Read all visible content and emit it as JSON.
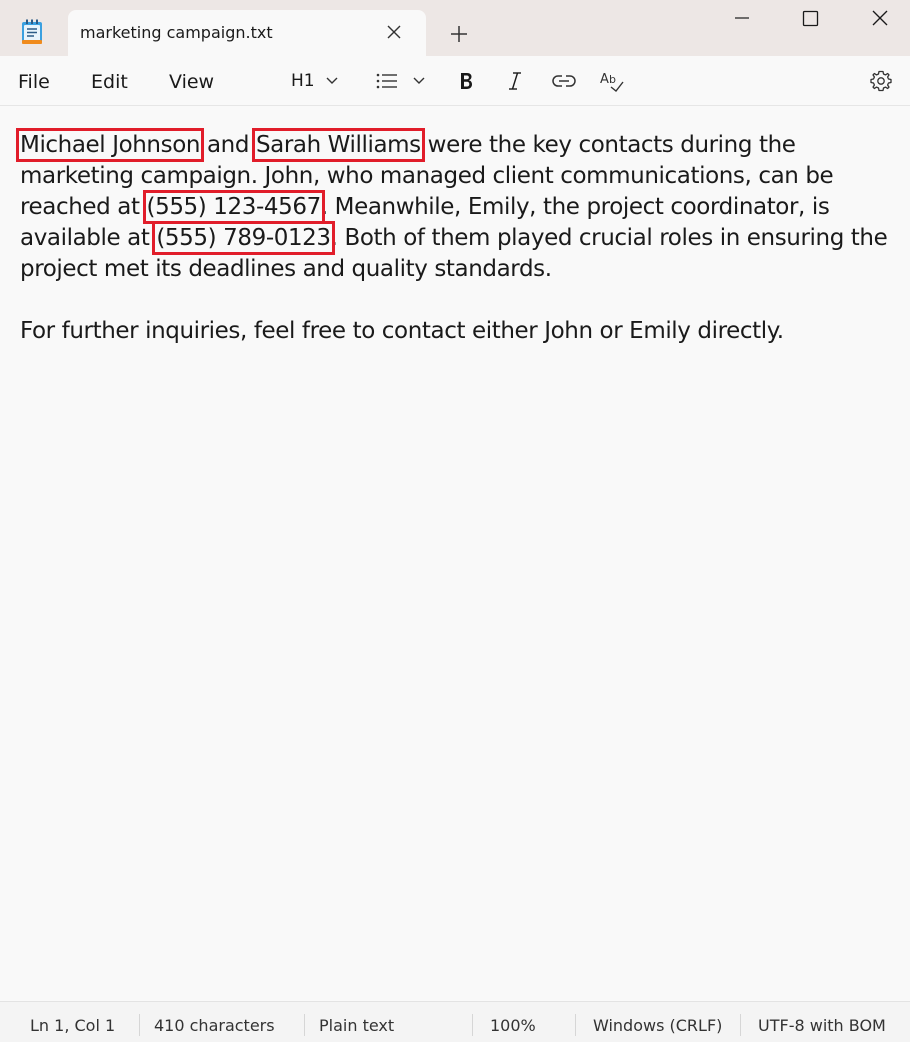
{
  "tab": {
    "title": "marketing campaign.txt"
  },
  "menu": {
    "file": "File",
    "edit": "Edit",
    "view": "View"
  },
  "toolbar": {
    "heading_label": "H1"
  },
  "icons": {
    "app": "notepad-icon",
    "tab_close": "close-icon",
    "new_tab": "plus-icon",
    "minimize": "minimize-icon",
    "maximize": "maximize-icon",
    "close": "close-icon",
    "heading_dropdown": "chevron-down-icon",
    "list": "list-icon",
    "bold": "bold-icon",
    "italic": "italic-icon",
    "link": "link-icon",
    "spellcheck": "spellcheck-icon",
    "settings": "gear-icon"
  },
  "document": {
    "p1": {
      "name1": "Michael Johnson",
      "t1": " and ",
      "name2": "Sarah Williams",
      "t2": " were the key contacts during the marketing campaign. John, who managed client communications, can be reached at ",
      "phone1": " (555)  123-4567",
      "t3": ". Meanwhile, Emily, the project coordinator, is available at ",
      "phone2": " (555)  789-0123",
      "t4": ". Both of them played crucial roles in ensuring the project met its deadlines and quality standards."
    },
    "p2": "For further inquiries, feel free to contact either John or Emily directly."
  },
  "status": {
    "position": "Ln 1, Col 1",
    "characters": "410 characters",
    "format": "Plain text",
    "zoom": "100%",
    "line_endings": "Windows (CRLF)",
    "encoding": "UTF-8 with BOM"
  },
  "colors": {
    "highlight_box": "#e11d2a",
    "titlebar": "#ede7e5",
    "editor_bg": "#f9f9f9"
  }
}
